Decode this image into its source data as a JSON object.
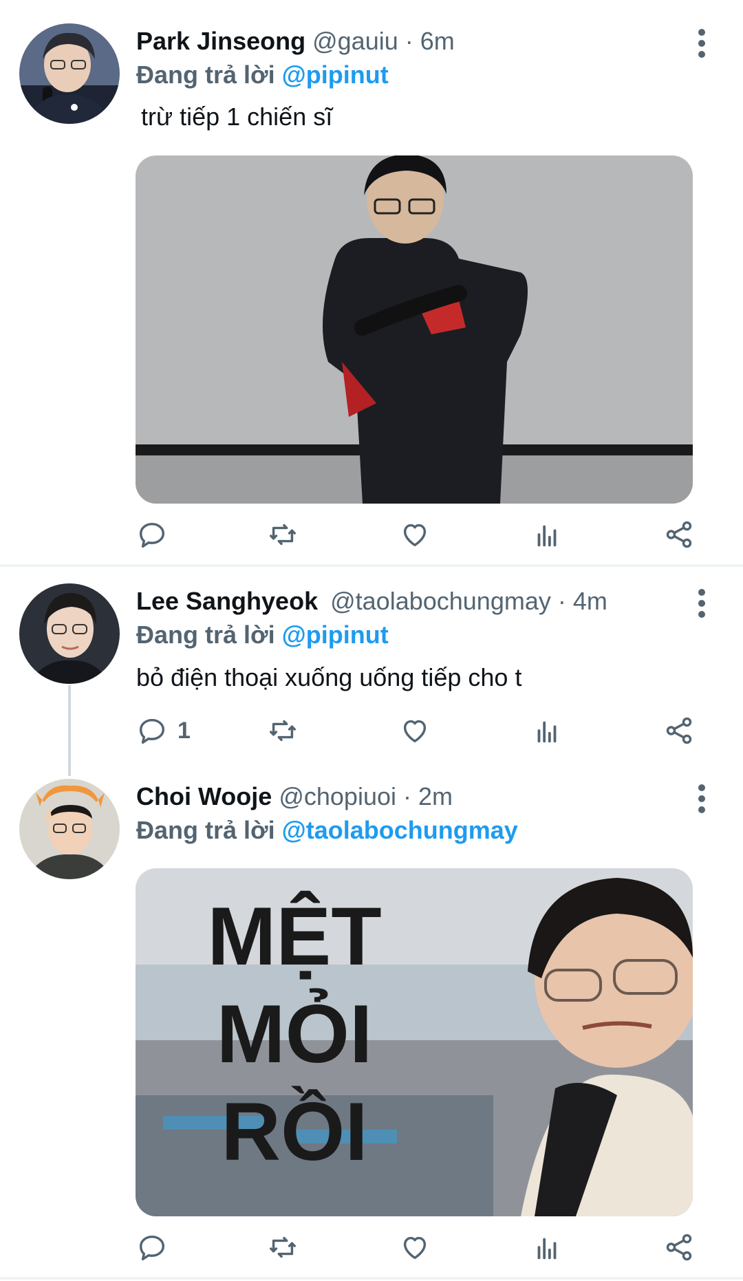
{
  "tweets": [
    {
      "name": "Park Jinseong",
      "handle": "@gauiu",
      "time": "· 6m",
      "reply_prefix": "Đang trả lời",
      "reply_to": "@pipinut",
      "text": "trừ tiếp 1 chiến sĩ",
      "reply_count": "",
      "media_icon": "photo-man-sitting-against-wall"
    },
    {
      "name": "Lee Sanghyeok",
      "handle": "@taolabochungmay",
      "time": "· 4m",
      "reply_prefix": "Đang trả lời",
      "reply_to": "@pipinut",
      "text": "bỏ điện thoại xuống uống tiếp cho t",
      "reply_count": "1"
    },
    {
      "name": "Choi Wooje",
      "handle": "@chopiuoi",
      "time": "· 2m",
      "reply_prefix": "Đang trả lời",
      "reply_to": "@taolabochungmay",
      "text": "",
      "reply_count": "",
      "media_text": [
        "MỆT",
        "MỎI",
        "RỒI"
      ]
    }
  ],
  "icons": {
    "reply": "reply-icon",
    "retweet": "retweet-icon",
    "like": "heart-icon",
    "views": "analytics-icon",
    "share": "share-icon",
    "more": "more-vertical-icon"
  },
  "colors": {
    "accent": "#1d9bf0",
    "secondary_text": "#536471",
    "divider": "#eff3f4"
  }
}
